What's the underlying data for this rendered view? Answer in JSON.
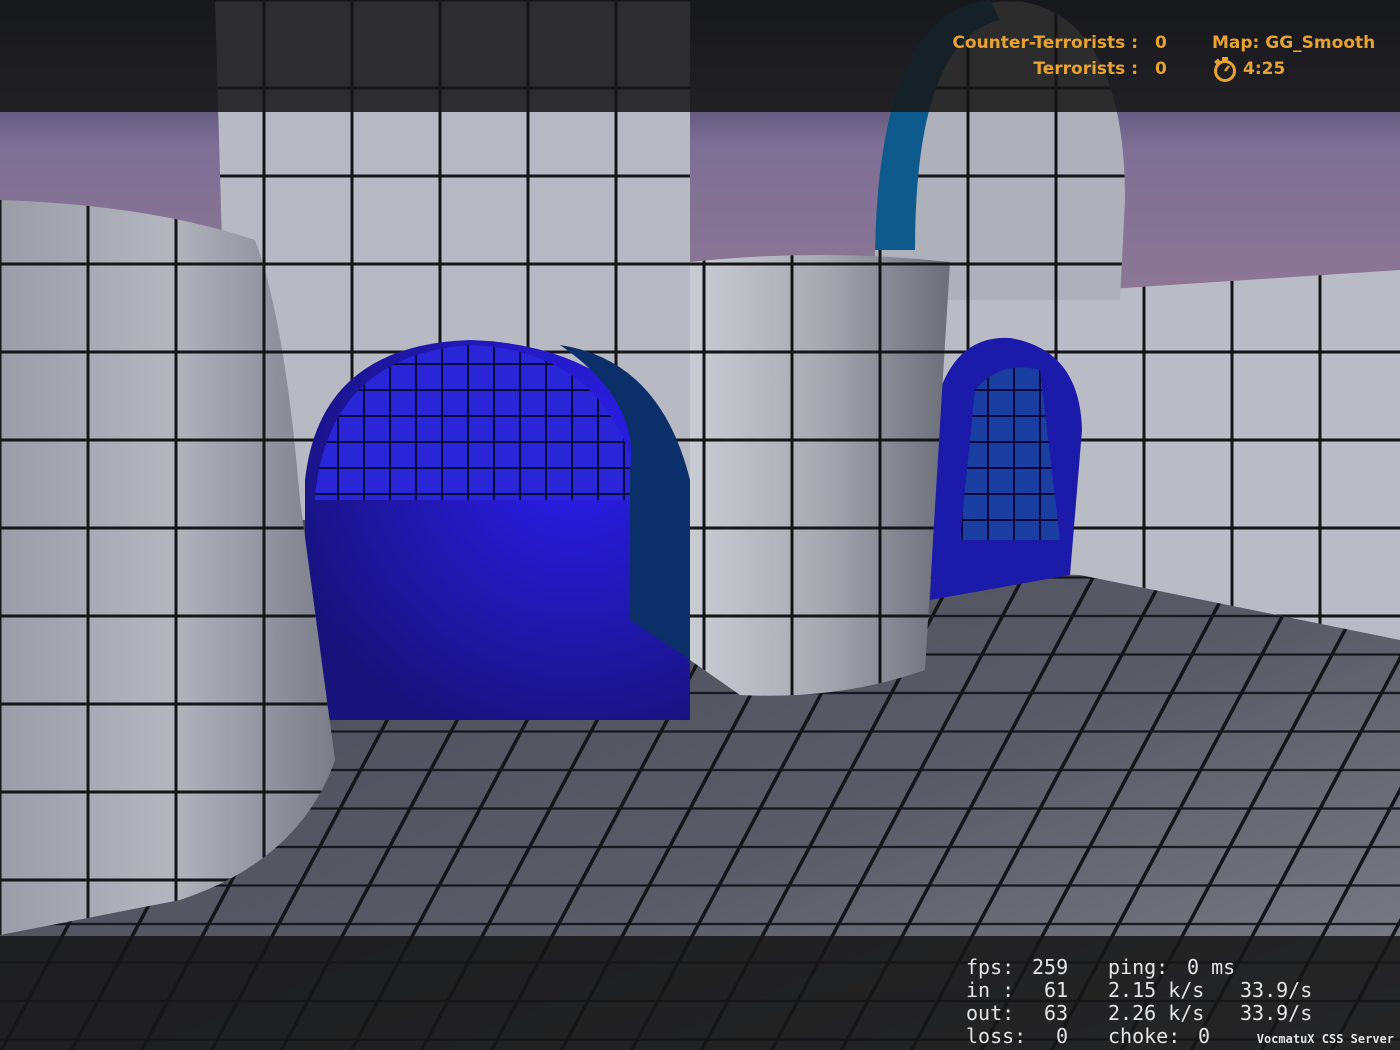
{
  "scoreboard": {
    "ct_label": "Counter-Terrorists :",
    "ct_score": "0",
    "t_label": "Terrorists :",
    "t_score": "0",
    "map_label": "Map: GG_Smooth",
    "timer_icon": "stopwatch-icon",
    "timer": "4:25"
  },
  "netgraph": {
    "fps_label": "fps:",
    "fps_value": "259",
    "ping_label": "ping:",
    "ping_value": "0 ms",
    "in_label": "in :",
    "in_packets": "61",
    "in_rate": "2.15 k/s",
    "in_updates": "33.9/s",
    "out_label": "out:",
    "out_packets": "63",
    "out_rate": "2.26 k/s",
    "out_updates": "33.9/s",
    "loss_label": "loss:",
    "loss_value": "0",
    "choke_label": "choke:",
    "choke_value": "0"
  },
  "server_name": "VocmatuX CSS Server",
  "colors": {
    "hud_text": "#e7a233",
    "netgraph_text": "#e4e4e4",
    "wall_tile": "#a9acb4",
    "floor_tile": "#5c5f68",
    "blue_room": "#2a1fd8",
    "sky": "#8f7f9e"
  }
}
